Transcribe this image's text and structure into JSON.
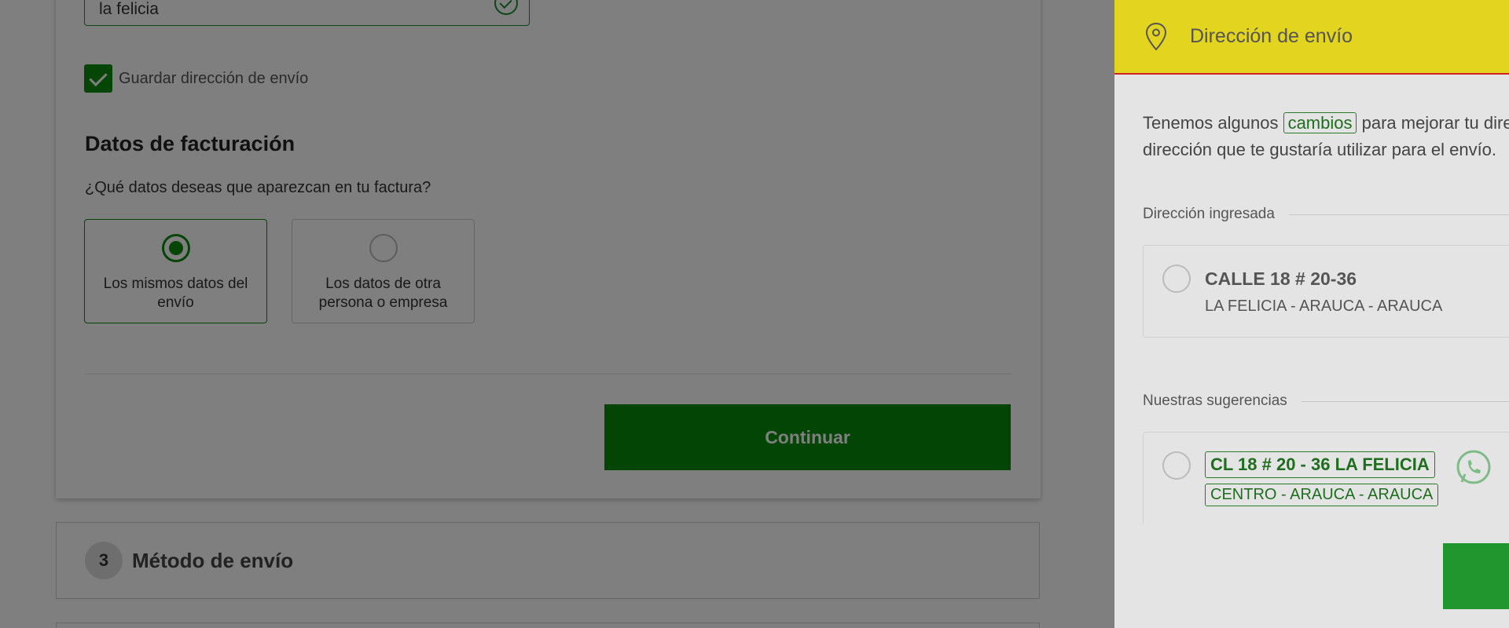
{
  "checkout": {
    "address_value": "la felicia",
    "save_address_label": "Guardar dirección de envío",
    "billing_title": "Datos de facturación",
    "billing_question": "¿Qué datos deseas que aparezcan en tu factura?",
    "billing_options": [
      {
        "label": "Los mismos datos del envío",
        "selected": true
      },
      {
        "label": "Los datos de otra persona o empresa",
        "selected": false
      }
    ],
    "continue_label": "Continuar",
    "step3": {
      "number": "3",
      "title": "Método de envío"
    }
  },
  "drawer": {
    "title": "Dirección de envío",
    "intro_before": "Tenemos algunos ",
    "intro_highlight": "cambios",
    "intro_after": " para mejorar tu dirección. Selecciona la dirección que te gustaría utilizar para el envío.",
    "entered_section": "Dirección ingresada",
    "entered_address": {
      "line1": "CALLE 18 # 20-36",
      "line2": "LA FELICIA - ARAUCA - ARAUCA"
    },
    "suggestions_section": "Nuestras sugerencias",
    "suggested_address": {
      "line1": "CL 18 # 20 - 36 LA FELICIA",
      "line2": "CENTRO - ARAUCA - ARAUCA"
    }
  },
  "colors": {
    "brand_green": "#078a0a",
    "header_yellow": "#e2d41f",
    "header_border_red": "#d21f1f"
  },
  "icons": [
    "check-icon",
    "location-pin-icon",
    "whatsapp-icon"
  ]
}
